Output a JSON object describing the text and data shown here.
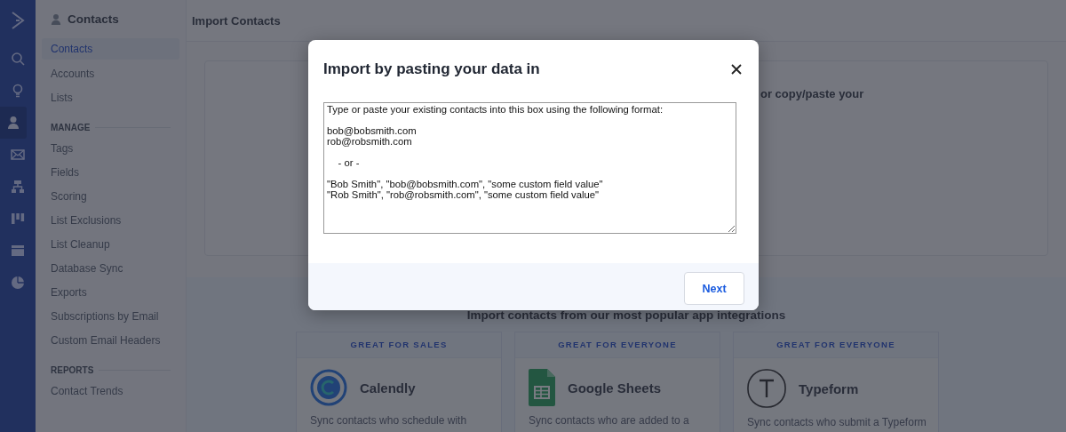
{
  "rail": {
    "items": [
      {
        "kind": "search",
        "selected": false
      },
      {
        "kind": "bulb",
        "selected": false
      },
      {
        "kind": "person",
        "selected": true
      },
      {
        "kind": "mail",
        "selected": false
      },
      {
        "kind": "org",
        "selected": false
      },
      {
        "kind": "board",
        "selected": false
      },
      {
        "kind": "window",
        "selected": false
      },
      {
        "kind": "pie",
        "selected": false
      }
    ]
  },
  "sidebar": {
    "title": "Contacts",
    "sections": [
      {
        "items": [
          {
            "label": "Contacts",
            "selected": true
          },
          {
            "label": "Accounts",
            "selected": false
          },
          {
            "label": "Lists",
            "selected": false
          }
        ]
      },
      {
        "heading": "MANAGE",
        "items": [
          {
            "label": "Tags",
            "selected": false
          },
          {
            "label": "Fields",
            "selected": false
          },
          {
            "label": "Scoring",
            "selected": false
          },
          {
            "label": "List Exclusions",
            "selected": false
          },
          {
            "label": "List Cleanup",
            "selected": false
          },
          {
            "label": "Database Sync",
            "selected": false
          },
          {
            "label": "Exports",
            "selected": false
          },
          {
            "label": "Subscriptions by Email",
            "selected": false
          },
          {
            "label": "Custom Email Headers",
            "selected": false
          }
        ]
      },
      {
        "heading": "REPORTS",
        "items": [
          {
            "label": "Contact Trends",
            "selected": false
          }
        ]
      }
    ]
  },
  "page": {
    "title": "Import Contacts",
    "upload_text": "or copy/paste your",
    "integrations_heading": "Import contacts from our most popular app integrations",
    "integrations": [
      {
        "tag": "GREAT FOR SALES",
        "name": "Calendly",
        "kind": "calendly",
        "description": "Sync contacts who schedule with"
      },
      {
        "tag": "GREAT FOR EVERYONE",
        "name": "Google Sheets",
        "kind": "sheets",
        "description": "Sync contacts who are added to a"
      },
      {
        "tag": "GREAT FOR EVERYONE",
        "name": "Typeform",
        "kind": "typeform",
        "description": "Sync contacts who submit a Typeform"
      }
    ]
  },
  "dialog": {
    "title": "Import by pasting your data in",
    "textarea": {
      "value": "Type or paste your existing contacts into this box using the following format:\n\nbob@bobsmith.com\nrob@robsmith.com\n\n    - or -\n\n\"Bob Smith\", \"bob@bobsmith.com\", \"some custom field value\"\n\"Rob Smith\", \"rob@robsmith.com\", \"some custom field value\""
    },
    "buttons": [
      "Next"
    ]
  }
}
